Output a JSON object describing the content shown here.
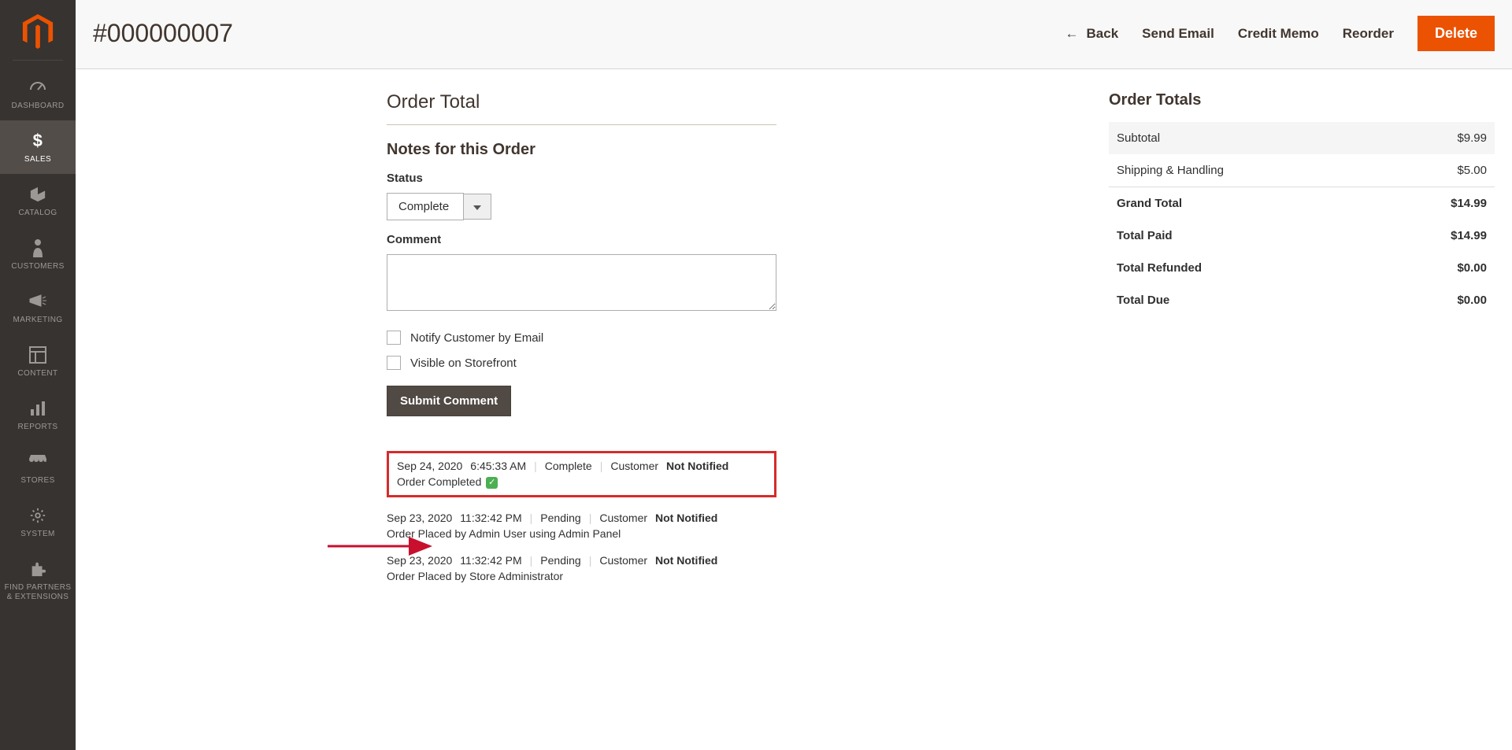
{
  "header": {
    "title": "#000000007",
    "back": "Back",
    "send_email": "Send Email",
    "credit_memo": "Credit Memo",
    "reorder": "Reorder",
    "delete": "Delete"
  },
  "sidebar": {
    "items": [
      {
        "label": "DASHBOARD"
      },
      {
        "label": "SALES"
      },
      {
        "label": "CATALOG"
      },
      {
        "label": "CUSTOMERS"
      },
      {
        "label": "MARKETING"
      },
      {
        "label": "CONTENT"
      },
      {
        "label": "REPORTS"
      },
      {
        "label": "STORES"
      },
      {
        "label": "SYSTEM"
      },
      {
        "label": "FIND PARTNERS\n& EXTENSIONS"
      }
    ]
  },
  "notes": {
    "section_title": "Order Total",
    "panel_title": "Notes for this Order",
    "status_label": "Status",
    "status_value": "Complete",
    "comment_label": "Comment",
    "notify_label": "Notify Customer by Email",
    "visible_label": "Visible on Storefront",
    "submit_label": "Submit Comment"
  },
  "totals": {
    "title": "Order Totals",
    "rows": [
      {
        "label": "Subtotal",
        "value": "$9.99"
      },
      {
        "label": "Shipping & Handling",
        "value": "$5.00"
      },
      {
        "label": "Grand Total",
        "value": "$14.99"
      },
      {
        "label": "Total Paid",
        "value": "$14.99"
      },
      {
        "label": "Total Refunded",
        "value": "$0.00"
      },
      {
        "label": "Total Due",
        "value": "$0.00"
      }
    ]
  },
  "history": [
    {
      "date": "Sep 24, 2020",
      "time": "6:45:33 AM",
      "status": "Complete",
      "cust_prefix": "Customer",
      "cust_state": "Not Notified",
      "body": "Order Completed",
      "check": true,
      "highlight": true
    },
    {
      "date": "Sep 23, 2020",
      "time": "11:32:42 PM",
      "status": "Pending",
      "cust_prefix": "Customer",
      "cust_state": "Not Notified",
      "body": "Order Placed by Admin User using Admin Panel"
    },
    {
      "date": "Sep 23, 2020",
      "time": "11:32:42 PM",
      "status": "Pending",
      "cust_prefix": "Customer",
      "cust_state": "Not Notified",
      "body": "Order Placed by Store Administrator"
    }
  ]
}
